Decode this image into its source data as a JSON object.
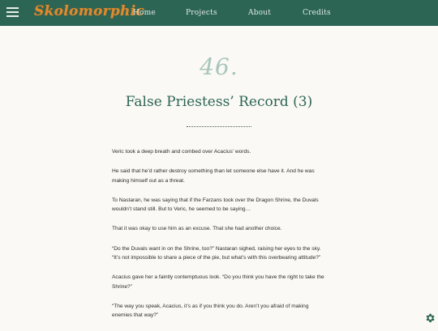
{
  "header": {
    "logo": "Skolomorphic",
    "nav": [
      "Home",
      "Projects",
      "About",
      "Credits"
    ]
  },
  "chapter": {
    "number": "46.",
    "title": "False Priestess’ Record (3)"
  },
  "paragraphs": [
    "Veric took a deep breath and combed over Acacius’ words.",
    "He said that he’d rather destroy something than let someone else have it. And he was making himself out as a threat.",
    "To Nastaran, he was saying that if the Farzans took over the Dragon Shrine, the Duvals wouldn’t stand still. But to Veric, he seemed to be saying…",
    "That it was okay to use him as an excuse. That she had another choice.",
    "“Do the Duvals want in on the Shrine, too?” Nastaran sighed, raising her eyes to the sky. “It’s not impossible to share a piece of the pie, but what’s with this overbearing attitude?”",
    "Acacius gave her a faintly contemptuous look. “Do you think you have the right to take the Shrine?”",
    "“The way you speak, Acacius, it’s as if you think you do. Aren’t you afraid of making enemies that way?”"
  ],
  "colors": {
    "header_bg": "#2d6555",
    "logo": "#e08a2c",
    "title": "#2d6555",
    "chapter_number": "#a8c5bc",
    "settings_icon": "#2d6555"
  },
  "icons": {
    "menu": "hamburger-menu-icon",
    "settings": "gear-icon"
  }
}
